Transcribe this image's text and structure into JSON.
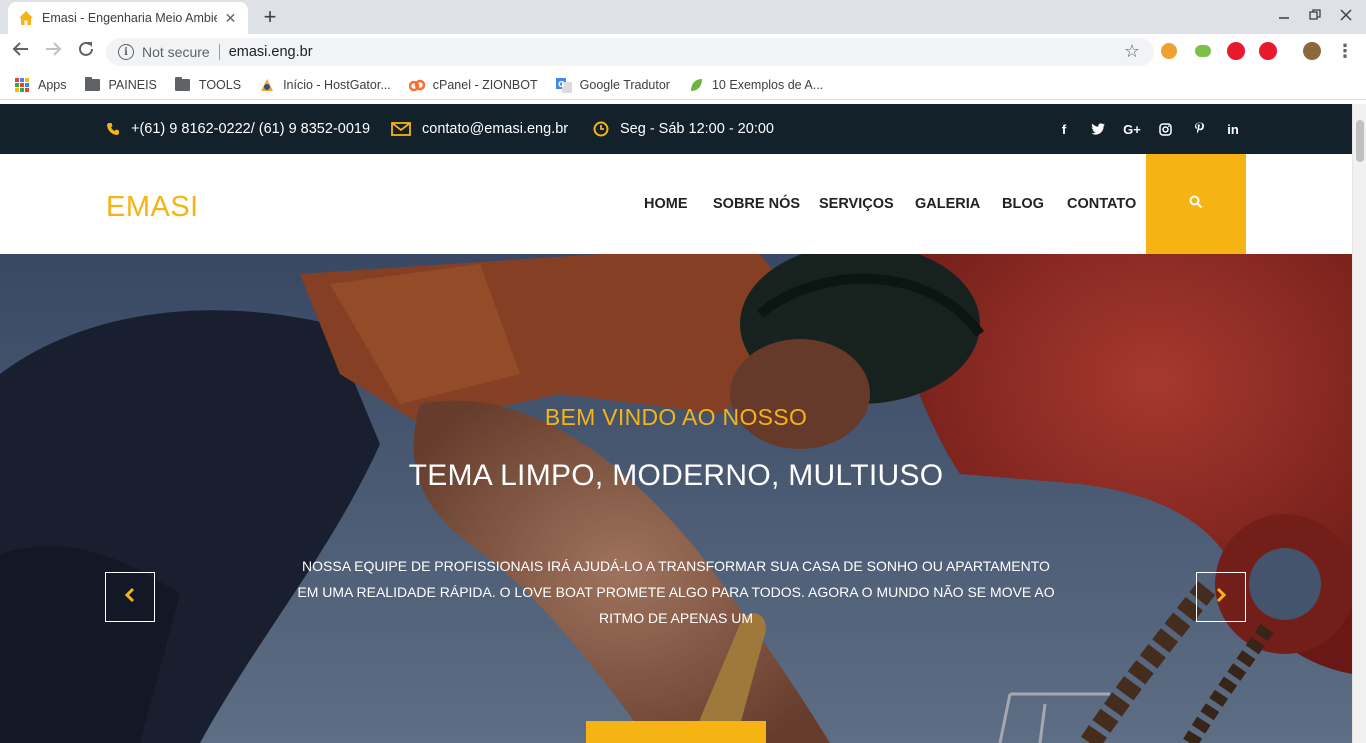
{
  "browser": {
    "tab_title": "Emasi - Engenharia Meio Ambiente",
    "security_label": "Not secure",
    "url": "emasi.eng.br",
    "bookmarks": [
      {
        "label": "Apps",
        "icon": "apps-grid-icon"
      },
      {
        "label": "PAINEIS",
        "icon": "folder-icon"
      },
      {
        "label": "TOOLS",
        "icon": "folder-icon"
      },
      {
        "label": "Início - HostGator...",
        "icon": "hostgator-icon"
      },
      {
        "label": "cPanel - ZIONBOT",
        "icon": "cpanel-icon"
      },
      {
        "label": "Google Tradutor",
        "icon": "google-translate-icon"
      },
      {
        "label": "10 Exemplos de A...",
        "icon": "leaf-icon"
      }
    ]
  },
  "site": {
    "colors": {
      "accent": "#f5b414",
      "topbar_bg": "#13212b"
    },
    "topbar": {
      "phone": "+(61) 9 8162-0222/ (61) 9 8352-0019",
      "email": "contato@emasi.eng.br",
      "hours": "Seg - Sáb 12:00 - 20:00",
      "social": [
        "f",
        "twitter",
        "G+",
        "instagram",
        "pinterest",
        "in"
      ]
    },
    "header": {
      "logo": "EMASI",
      "nav": [
        "HOME",
        "SOBRE NÓS",
        "SERVIÇOS",
        "GALERIA",
        "BLOG",
        "CONTATO"
      ]
    },
    "hero": {
      "subtitle": "BEM VINDO AO NOSSO",
      "title": "TEMA LIMPO, MODERNO, MULTIUSO",
      "text": "NOSSA EQUIPE DE PROFISSIONAIS IRÁ AJUDÁ-LO A TRANSFORMAR SUA CASA DE SONHO OU APARTAMENTO EM UMA REALIDADE RÁPIDA. O LOVE BOAT PROMETE ALGO PARA TODOS. AGORA O MUNDO NÃO SE MOVE AO RITMO DE APENAS UM"
    }
  }
}
